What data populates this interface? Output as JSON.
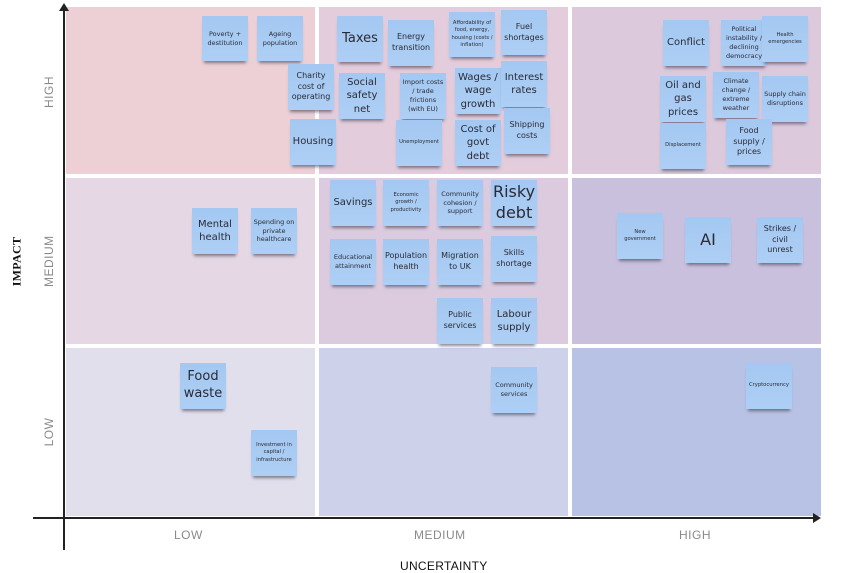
{
  "axes": {
    "x_title": "UNCERTAINTY",
    "y_title": "IMPACT",
    "x_levels": [
      "LOW",
      "MEDIUM",
      "HIGH"
    ],
    "y_levels": [
      "HIGH",
      "MEDIUM",
      "LOW"
    ]
  },
  "quadrant_colors": {
    "high_low": "#ecd0d6",
    "high_medium": "#e3ccdb",
    "high_high": "#dcc9dc",
    "medium_low": "#e5d7e3",
    "medium_medium": "#dccbdf",
    "medium_high": "#c9c0de",
    "low_low": "#e1dfec",
    "low_medium": "#cdd1ea",
    "low_high": "#b8c2e4"
  },
  "note_color": "#a8cbf3",
  "notes": [
    {
      "text": "Poverty + destitution",
      "impact": "HIGH",
      "uncertainty": "LOW"
    },
    {
      "text": "Ageing population",
      "impact": "HIGH",
      "uncertainty": "LOW"
    },
    {
      "text": "Charity cost of operating",
      "impact": "HIGH",
      "uncertainty": "LOW"
    },
    {
      "text": "Housing",
      "impact": "HIGH",
      "uncertainty": "LOW"
    },
    {
      "text": "Taxes",
      "impact": "HIGH",
      "uncertainty": "MEDIUM"
    },
    {
      "text": "Energy transition",
      "impact": "HIGH",
      "uncertainty": "MEDIUM"
    },
    {
      "text": "Affordability of food, energy, housing (costs / inflation)",
      "impact": "HIGH",
      "uncertainty": "MEDIUM"
    },
    {
      "text": "Fuel shortages",
      "impact": "HIGH",
      "uncertainty": "MEDIUM"
    },
    {
      "text": "Social safety net",
      "impact": "HIGH",
      "uncertainty": "MEDIUM"
    },
    {
      "text": "Import costs / trade frictions (with EU)",
      "impact": "HIGH",
      "uncertainty": "MEDIUM"
    },
    {
      "text": "Wages / wage growth",
      "impact": "HIGH",
      "uncertainty": "MEDIUM"
    },
    {
      "text": "Interest rates",
      "impact": "HIGH",
      "uncertainty": "MEDIUM"
    },
    {
      "text": "Unemployment",
      "impact": "HIGH",
      "uncertainty": "MEDIUM"
    },
    {
      "text": "Cost of govt debt",
      "impact": "HIGH",
      "uncertainty": "MEDIUM"
    },
    {
      "text": "Shipping costs",
      "impact": "HIGH",
      "uncertainty": "MEDIUM"
    },
    {
      "text": "Conflict",
      "impact": "HIGH",
      "uncertainty": "HIGH"
    },
    {
      "text": "Political instability / declining democracy",
      "impact": "HIGH",
      "uncertainty": "HIGH"
    },
    {
      "text": "Health emergencies",
      "impact": "HIGH",
      "uncertainty": "HIGH"
    },
    {
      "text": "Oil and gas prices",
      "impact": "HIGH",
      "uncertainty": "HIGH"
    },
    {
      "text": "Climate change / extreme weather",
      "impact": "HIGH",
      "uncertainty": "HIGH"
    },
    {
      "text": "Supply chain disruptions",
      "impact": "HIGH",
      "uncertainty": "HIGH"
    },
    {
      "text": "Displacement",
      "impact": "HIGH",
      "uncertainty": "HIGH"
    },
    {
      "text": "Food supply / prices",
      "impact": "HIGH",
      "uncertainty": "HIGH"
    },
    {
      "text": "Mental health",
      "impact": "MEDIUM",
      "uncertainty": "LOW"
    },
    {
      "text": "Spending on private healthcare",
      "impact": "MEDIUM",
      "uncertainty": "LOW"
    },
    {
      "text": "Savings",
      "impact": "MEDIUM",
      "uncertainty": "MEDIUM"
    },
    {
      "text": "Economic growth / productivity",
      "impact": "MEDIUM",
      "uncertainty": "MEDIUM"
    },
    {
      "text": "Community cohesion / support",
      "impact": "MEDIUM",
      "uncertainty": "MEDIUM"
    },
    {
      "text": "Risky debt",
      "impact": "MEDIUM",
      "uncertainty": "MEDIUM"
    },
    {
      "text": "Educational attainment",
      "impact": "MEDIUM",
      "uncertainty": "MEDIUM"
    },
    {
      "text": "Population health",
      "impact": "MEDIUM",
      "uncertainty": "MEDIUM"
    },
    {
      "text": "Migration to UK",
      "impact": "MEDIUM",
      "uncertainty": "MEDIUM"
    },
    {
      "text": "Skills shortage",
      "impact": "MEDIUM",
      "uncertainty": "MEDIUM"
    },
    {
      "text": "Public services",
      "impact": "MEDIUM",
      "uncertainty": "MEDIUM"
    },
    {
      "text": "Labour supply",
      "impact": "MEDIUM",
      "uncertainty": "MEDIUM"
    },
    {
      "text": "New government",
      "impact": "MEDIUM",
      "uncertainty": "HIGH"
    },
    {
      "text": "AI",
      "impact": "MEDIUM",
      "uncertainty": "HIGH"
    },
    {
      "text": "Strikes / civil unrest",
      "impact": "MEDIUM",
      "uncertainty": "HIGH"
    },
    {
      "text": "Food waste",
      "impact": "LOW",
      "uncertainty": "LOW"
    },
    {
      "text": "Investment in capital / infrastructure",
      "impact": "LOW",
      "uncertainty": "LOW"
    },
    {
      "text": "Community services",
      "impact": "LOW",
      "uncertainty": "MEDIUM"
    },
    {
      "text": "Cryptocurrency",
      "impact": "LOW",
      "uncertainty": "HIGH"
    }
  ]
}
